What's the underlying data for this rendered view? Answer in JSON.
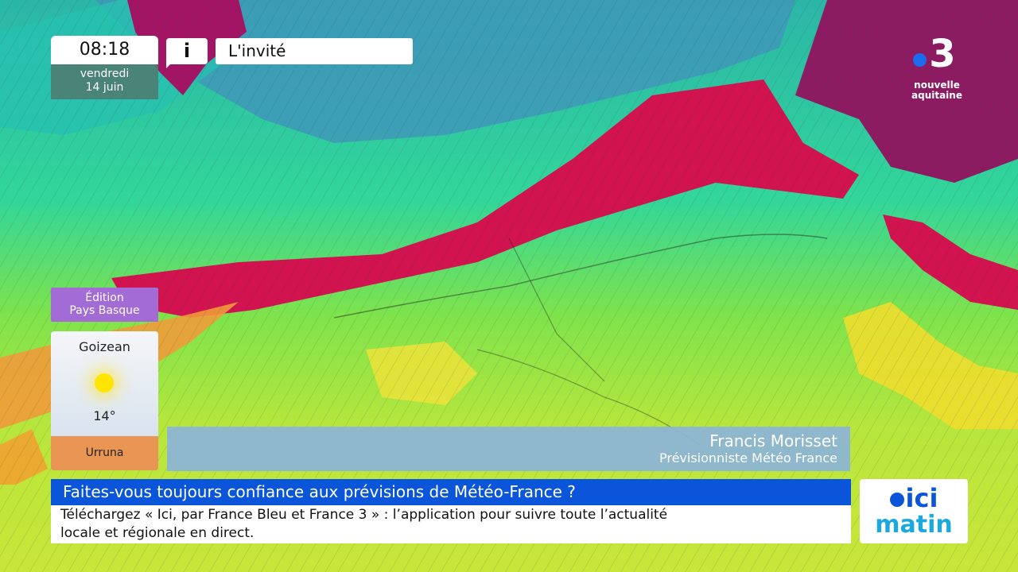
{
  "clock": {
    "time": "08:18",
    "day": "vendredi",
    "date": "14 juin"
  },
  "info_icon": {
    "glyph": "i",
    "name": "info-icon"
  },
  "section_title": "L'invité",
  "edition": {
    "line1": "Édition",
    "line2": "Pays Basque"
  },
  "weather": {
    "period": "Goizean",
    "icon": "sun-icon",
    "temperature": "14°",
    "location": "Urruna"
  },
  "guest": {
    "name": "Francis Morisset",
    "role": "Prévisionniste Météo France"
  },
  "headline": "Faites-vous toujours confiance aux prévisions de Météo-France ?",
  "ticker": {
    "line1": "Téléchargez « Ici, par France Bleu et France 3 » : l’application pour suivre toute l’actualité",
    "line2": "locale et régionale en direct."
  },
  "channel_logo": {
    "number": "3",
    "line1": "nouvelle",
    "line2": "aquitaine"
  },
  "program_logo": {
    "top": "ici",
    "bottom": "matin"
  },
  "colors": {
    "headline_blue": "#0a55d9",
    "edition_purple": "#a26bd6",
    "location_orange": "#e99554",
    "name_bar": "#8cb4d7"
  }
}
